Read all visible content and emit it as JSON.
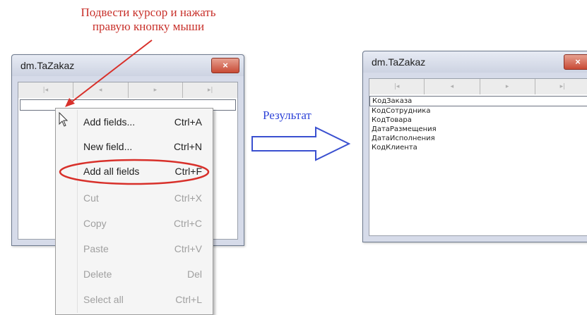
{
  "annotation": {
    "line1": "Подвести курсор и нажать",
    "line2": "правую кнопку мыши"
  },
  "window_left": {
    "title": "dm.TaZakaz",
    "close_label": "×",
    "nav_buttons": [
      "|◂",
      "◂",
      "▸",
      "▸|"
    ]
  },
  "context_menu": {
    "items": [
      {
        "label": "Add fields...",
        "shortcut": "Ctrl+A",
        "enabled": true
      },
      {
        "label": "New field...",
        "shortcut": "Ctrl+N",
        "enabled": true
      },
      {
        "label": "Add all fields",
        "shortcut": "Ctrl+F",
        "enabled": true,
        "highlighted": true
      },
      {
        "label": "Cut",
        "shortcut": "Ctrl+X",
        "enabled": false
      },
      {
        "label": "Copy",
        "shortcut": "Ctrl+C",
        "enabled": false
      },
      {
        "label": "Paste",
        "shortcut": "Ctrl+V",
        "enabled": false
      },
      {
        "label": "Delete",
        "shortcut": "Del",
        "enabled": false
      },
      {
        "label": "Select all",
        "shortcut": "Ctrl+L",
        "enabled": false
      }
    ]
  },
  "result_label": "Результат",
  "window_right": {
    "title": "dm.TaZakaz",
    "close_label": "×",
    "nav_buttons": [
      "|◂",
      "◂",
      "▸",
      "▸|"
    ],
    "fields": [
      "КодЗаказа",
      "КодСотрудника",
      "КодТовара",
      "ДатаРазмещения",
      "ДатаИсполнения",
      "КодКлиента"
    ]
  },
  "colors": {
    "annotation": "#c8302a",
    "result_label": "#2f44d8",
    "highlight_ellipse": "#d8302a",
    "arrow_outline": "#3a50d0"
  }
}
